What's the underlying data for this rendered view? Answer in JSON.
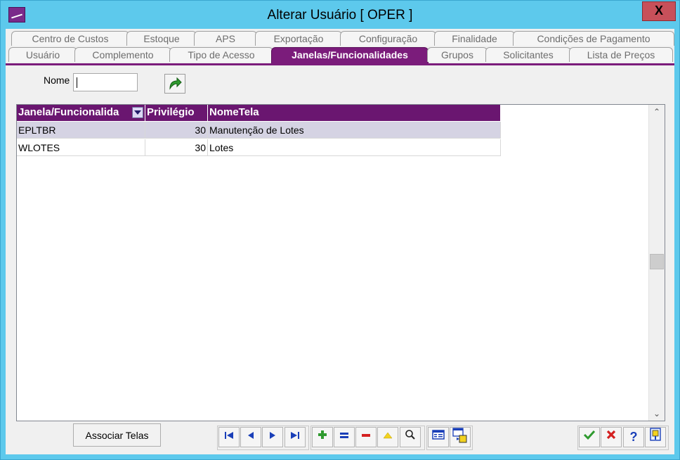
{
  "window": {
    "title": "Alterar Usuário [ OPER ]",
    "close_label": "X"
  },
  "tabs": {
    "row1": [
      "Centro de Custos",
      "Estoque",
      "APS",
      "Exportação",
      "Configuração",
      "Finalidade",
      "Condições de Pagamento"
    ],
    "row2": [
      "Usuário",
      "Complemento",
      "Tipo de Acesso",
      "Janelas/Funcionalidades",
      "Grupos",
      "Solicitantes",
      "Lista de Preços"
    ],
    "active": "Janelas/Funcionalidades"
  },
  "filter": {
    "label": "Nome",
    "value": ""
  },
  "grid": {
    "columns": [
      "Janela/Funcionalida",
      "Privilégio",
      "NomeTela"
    ],
    "rows": [
      {
        "janela": "EPLTBR",
        "privilegio": "30",
        "nome_tela": "Manutenção de Lotes"
      },
      {
        "janela": "WLOTES",
        "privilegio": "30",
        "nome_tela": "Lotes"
      }
    ]
  },
  "footer": {
    "associar_label": "Associar Telas"
  },
  "colors": {
    "accent": "#7b1c7b",
    "title_bg": "#5dc9ec",
    "selected_row": "#d5d3e3"
  }
}
